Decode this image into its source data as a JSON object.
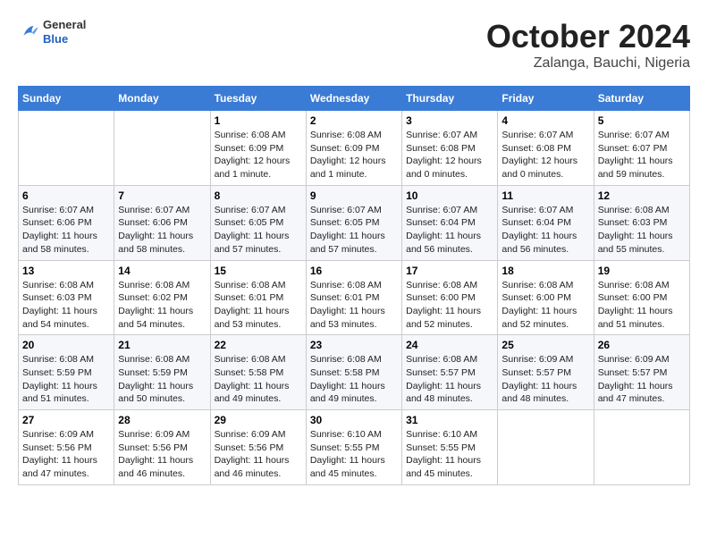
{
  "header": {
    "logo_general": "General",
    "logo_blue": "Blue",
    "title": "October 2024",
    "subtitle": "Zalanga, Bauchi, Nigeria"
  },
  "calendar": {
    "headers": [
      "Sunday",
      "Monday",
      "Tuesday",
      "Wednesday",
      "Thursday",
      "Friday",
      "Saturday"
    ],
    "weeks": [
      [
        {
          "day": "",
          "detail": ""
        },
        {
          "day": "",
          "detail": ""
        },
        {
          "day": "1",
          "detail": "Sunrise: 6:08 AM\nSunset: 6:09 PM\nDaylight: 12 hours\nand 1 minute."
        },
        {
          "day": "2",
          "detail": "Sunrise: 6:08 AM\nSunset: 6:09 PM\nDaylight: 12 hours\nand 1 minute."
        },
        {
          "day": "3",
          "detail": "Sunrise: 6:07 AM\nSunset: 6:08 PM\nDaylight: 12 hours\nand 0 minutes."
        },
        {
          "day": "4",
          "detail": "Sunrise: 6:07 AM\nSunset: 6:08 PM\nDaylight: 12 hours\nand 0 minutes."
        },
        {
          "day": "5",
          "detail": "Sunrise: 6:07 AM\nSunset: 6:07 PM\nDaylight: 11 hours\nand 59 minutes."
        }
      ],
      [
        {
          "day": "6",
          "detail": "Sunrise: 6:07 AM\nSunset: 6:06 PM\nDaylight: 11 hours\nand 58 minutes."
        },
        {
          "day": "7",
          "detail": "Sunrise: 6:07 AM\nSunset: 6:06 PM\nDaylight: 11 hours\nand 58 minutes."
        },
        {
          "day": "8",
          "detail": "Sunrise: 6:07 AM\nSunset: 6:05 PM\nDaylight: 11 hours\nand 57 minutes."
        },
        {
          "day": "9",
          "detail": "Sunrise: 6:07 AM\nSunset: 6:05 PM\nDaylight: 11 hours\nand 57 minutes."
        },
        {
          "day": "10",
          "detail": "Sunrise: 6:07 AM\nSunset: 6:04 PM\nDaylight: 11 hours\nand 56 minutes."
        },
        {
          "day": "11",
          "detail": "Sunrise: 6:07 AM\nSunset: 6:04 PM\nDaylight: 11 hours\nand 56 minutes."
        },
        {
          "day": "12",
          "detail": "Sunrise: 6:08 AM\nSunset: 6:03 PM\nDaylight: 11 hours\nand 55 minutes."
        }
      ],
      [
        {
          "day": "13",
          "detail": "Sunrise: 6:08 AM\nSunset: 6:03 PM\nDaylight: 11 hours\nand 54 minutes."
        },
        {
          "day": "14",
          "detail": "Sunrise: 6:08 AM\nSunset: 6:02 PM\nDaylight: 11 hours\nand 54 minutes."
        },
        {
          "day": "15",
          "detail": "Sunrise: 6:08 AM\nSunset: 6:01 PM\nDaylight: 11 hours\nand 53 minutes."
        },
        {
          "day": "16",
          "detail": "Sunrise: 6:08 AM\nSunset: 6:01 PM\nDaylight: 11 hours\nand 53 minutes."
        },
        {
          "day": "17",
          "detail": "Sunrise: 6:08 AM\nSunset: 6:00 PM\nDaylight: 11 hours\nand 52 minutes."
        },
        {
          "day": "18",
          "detail": "Sunrise: 6:08 AM\nSunset: 6:00 PM\nDaylight: 11 hours\nand 52 minutes."
        },
        {
          "day": "19",
          "detail": "Sunrise: 6:08 AM\nSunset: 6:00 PM\nDaylight: 11 hours\nand 51 minutes."
        }
      ],
      [
        {
          "day": "20",
          "detail": "Sunrise: 6:08 AM\nSunset: 5:59 PM\nDaylight: 11 hours\nand 51 minutes."
        },
        {
          "day": "21",
          "detail": "Sunrise: 6:08 AM\nSunset: 5:59 PM\nDaylight: 11 hours\nand 50 minutes."
        },
        {
          "day": "22",
          "detail": "Sunrise: 6:08 AM\nSunset: 5:58 PM\nDaylight: 11 hours\nand 49 minutes."
        },
        {
          "day": "23",
          "detail": "Sunrise: 6:08 AM\nSunset: 5:58 PM\nDaylight: 11 hours\nand 49 minutes."
        },
        {
          "day": "24",
          "detail": "Sunrise: 6:08 AM\nSunset: 5:57 PM\nDaylight: 11 hours\nand 48 minutes."
        },
        {
          "day": "25",
          "detail": "Sunrise: 6:09 AM\nSunset: 5:57 PM\nDaylight: 11 hours\nand 48 minutes."
        },
        {
          "day": "26",
          "detail": "Sunrise: 6:09 AM\nSunset: 5:57 PM\nDaylight: 11 hours\nand 47 minutes."
        }
      ],
      [
        {
          "day": "27",
          "detail": "Sunrise: 6:09 AM\nSunset: 5:56 PM\nDaylight: 11 hours\nand 47 minutes."
        },
        {
          "day": "28",
          "detail": "Sunrise: 6:09 AM\nSunset: 5:56 PM\nDaylight: 11 hours\nand 46 minutes."
        },
        {
          "day": "29",
          "detail": "Sunrise: 6:09 AM\nSunset: 5:56 PM\nDaylight: 11 hours\nand 46 minutes."
        },
        {
          "day": "30",
          "detail": "Sunrise: 6:10 AM\nSunset: 5:55 PM\nDaylight: 11 hours\nand 45 minutes."
        },
        {
          "day": "31",
          "detail": "Sunrise: 6:10 AM\nSunset: 5:55 PM\nDaylight: 11 hours\nand 45 minutes."
        },
        {
          "day": "",
          "detail": ""
        },
        {
          "day": "",
          "detail": ""
        }
      ]
    ]
  }
}
